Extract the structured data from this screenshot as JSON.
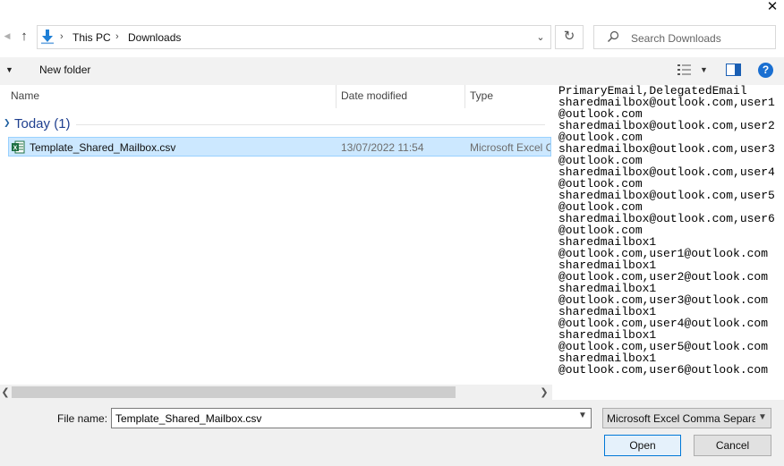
{
  "window": {
    "close_glyph": "✕"
  },
  "address_bar": {
    "crumbs": [
      "This PC",
      "Downloads"
    ],
    "separator": "›"
  },
  "search": {
    "placeholder": "Search Downloads"
  },
  "toolbar": {
    "new_folder_label": "New folder",
    "help_label": "?"
  },
  "columns": {
    "name": "Name",
    "date_modified": "Date modified",
    "type": "Type"
  },
  "group": {
    "label": "Today (1)"
  },
  "file": {
    "name": "Template_Shared_Mailbox.csv",
    "date": "13/07/2022 11:54",
    "type": "Microsoft Excel Comma Separated Values File"
  },
  "preview": {
    "lines": [
      "PrimaryEmail,DelegatedEmail",
      "sharedmailbox@outlook.com,user1",
      "@outlook.com",
      "sharedmailbox@outlook.com,user2",
      "@outlook.com",
      "sharedmailbox@outlook.com,user3",
      "@outlook.com",
      "sharedmailbox@outlook.com,user4",
      "@outlook.com",
      "sharedmailbox@outlook.com,user5",
      "@outlook.com",
      "sharedmailbox@outlook.com,user6",
      "@outlook.com",
      "sharedmailbox1",
      "@outlook.com,user1@outlook.com",
      "sharedmailbox1",
      "@outlook.com,user2@outlook.com",
      "sharedmailbox1",
      "@outlook.com,user3@outlook.com",
      "sharedmailbox1",
      "@outlook.com,user4@outlook.com",
      "sharedmailbox1",
      "@outlook.com,user5@outlook.com",
      "sharedmailbox1",
      "@outlook.com,user6@outlook.com"
    ]
  },
  "footer": {
    "file_name_label": "File name:",
    "file_name_value": "Template_Shared_Mailbox.csv",
    "file_type_value": "Microsoft Excel Comma Separated Values File",
    "open_label": "Open",
    "cancel_label": "Cancel"
  },
  "colors": {
    "accent": "#0078d7",
    "selection": "#cce8ff",
    "group_text": "#1e3f8f"
  },
  "icons": [
    "close-icon",
    "back-icon",
    "up-arrow-icon",
    "download-folder-icon",
    "chevron-down-icon",
    "refresh-icon",
    "search-icon",
    "view-options-icon",
    "preview-pane-icon",
    "help-icon",
    "excel-file-icon"
  ]
}
